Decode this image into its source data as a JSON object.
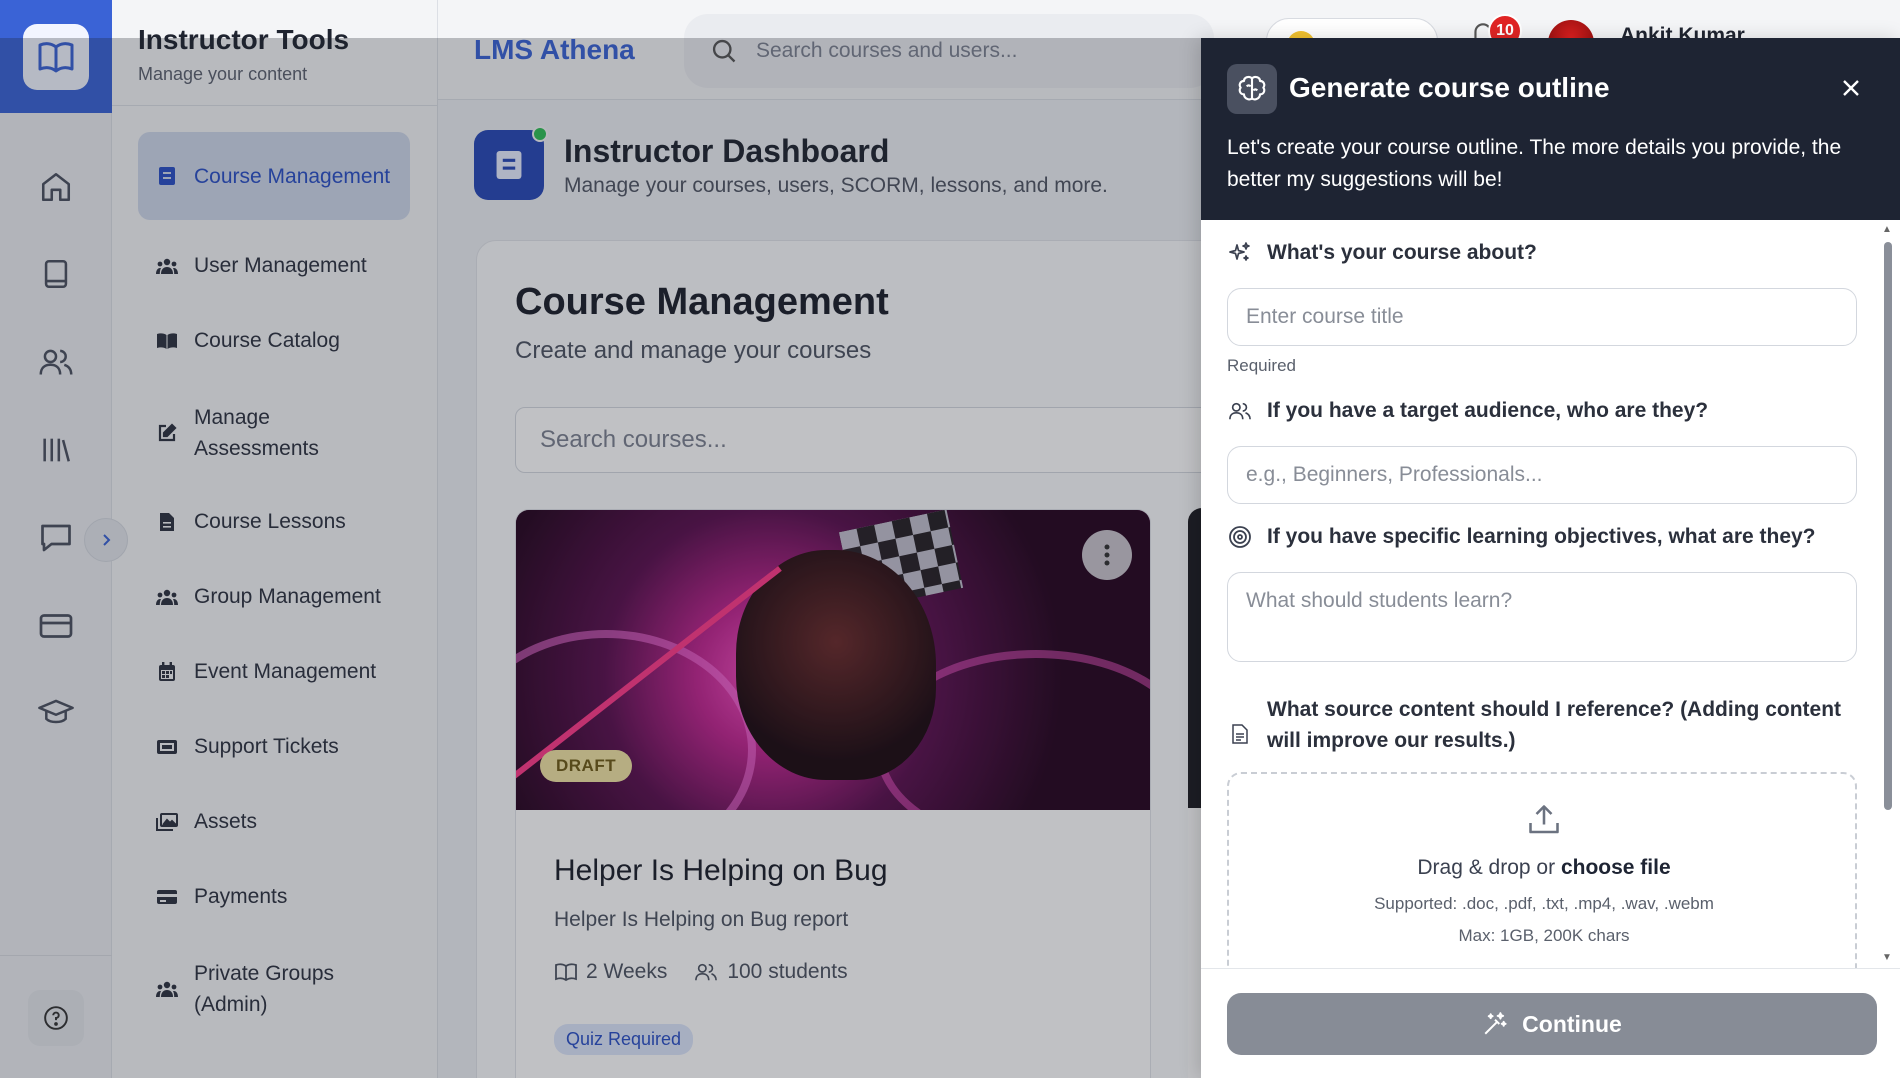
{
  "app": {
    "brand": "LMS Athena",
    "search_placeholder": "Search courses and users...",
    "notification_count": "10",
    "user_name": "Ankit Kumar"
  },
  "sidenav": {
    "title": "Instructor Tools",
    "subtitle": "Manage your content",
    "items": [
      {
        "label": "Course Management",
        "icon": "book-icon",
        "active": true
      },
      {
        "label": "User Management",
        "icon": "users-icon"
      },
      {
        "label": "Course Catalog",
        "icon": "open-book-icon"
      },
      {
        "label": "Manage Assessments",
        "icon": "edit-icon"
      },
      {
        "label": "Course Lessons",
        "icon": "document-icon"
      },
      {
        "label": "Group Management",
        "icon": "users-icon"
      },
      {
        "label": "Event Management",
        "icon": "calendar-icon"
      },
      {
        "label": "Support Tickets",
        "icon": "ticket-icon"
      },
      {
        "label": "Assets",
        "icon": "images-icon"
      },
      {
        "label": "Payments",
        "icon": "credit-card-icon"
      },
      {
        "label": "Private Groups (Admin)",
        "icon": "users-icon"
      }
    ]
  },
  "rail": {
    "icons": [
      "home-icon",
      "book-icon",
      "users-icon",
      "library-icon",
      "chat-icon",
      "credit-card-icon",
      "graduation-cap-icon",
      "help-icon"
    ]
  },
  "dashboard": {
    "title": "Instructor Dashboard",
    "subtitle": "Manage your courses, users, SCORM, lessons, and more."
  },
  "course_management": {
    "title": "Course Management",
    "subtitle": "Create and manage your courses",
    "search_placeholder": "Search courses...",
    "courses": [
      {
        "status": "DRAFT",
        "name": "Helper Is Helping on Bug",
        "description": "Helper Is Helping on Bug report",
        "duration": "2 Weeks",
        "students": "100 students",
        "badge": "Quiz Required"
      }
    ]
  },
  "panel": {
    "title": "Generate course outline",
    "description": "Let's create your course outline. The more details you provide, the better my suggestions will be!",
    "q1": {
      "label": "What's your course about?",
      "placeholder": "Enter course title",
      "hint": "Required"
    },
    "q2": {
      "label": "If you have a target audience, who are they?",
      "placeholder": "e.g., Beginners, Professionals..."
    },
    "q3": {
      "label": "If you have specific learning objectives, what are they?",
      "placeholder": "What should students learn?"
    },
    "q4": {
      "label": "What source content should I reference? (Adding content will improve our results.)"
    },
    "dropzone": {
      "text": "Drag & drop or",
      "link": "choose file",
      "supported": "Supported: .doc, .pdf, .txt, .mp4, .wav, .webm",
      "max": "Max: 1GB, 200K chars"
    },
    "continue_label": "Continue"
  },
  "colors": {
    "accent": "#3a63d6",
    "panel_header": "#1e2433",
    "disabled_button": "#878c96",
    "draft_badge": "#f2e3a4",
    "notification_badge": "#e02424"
  }
}
